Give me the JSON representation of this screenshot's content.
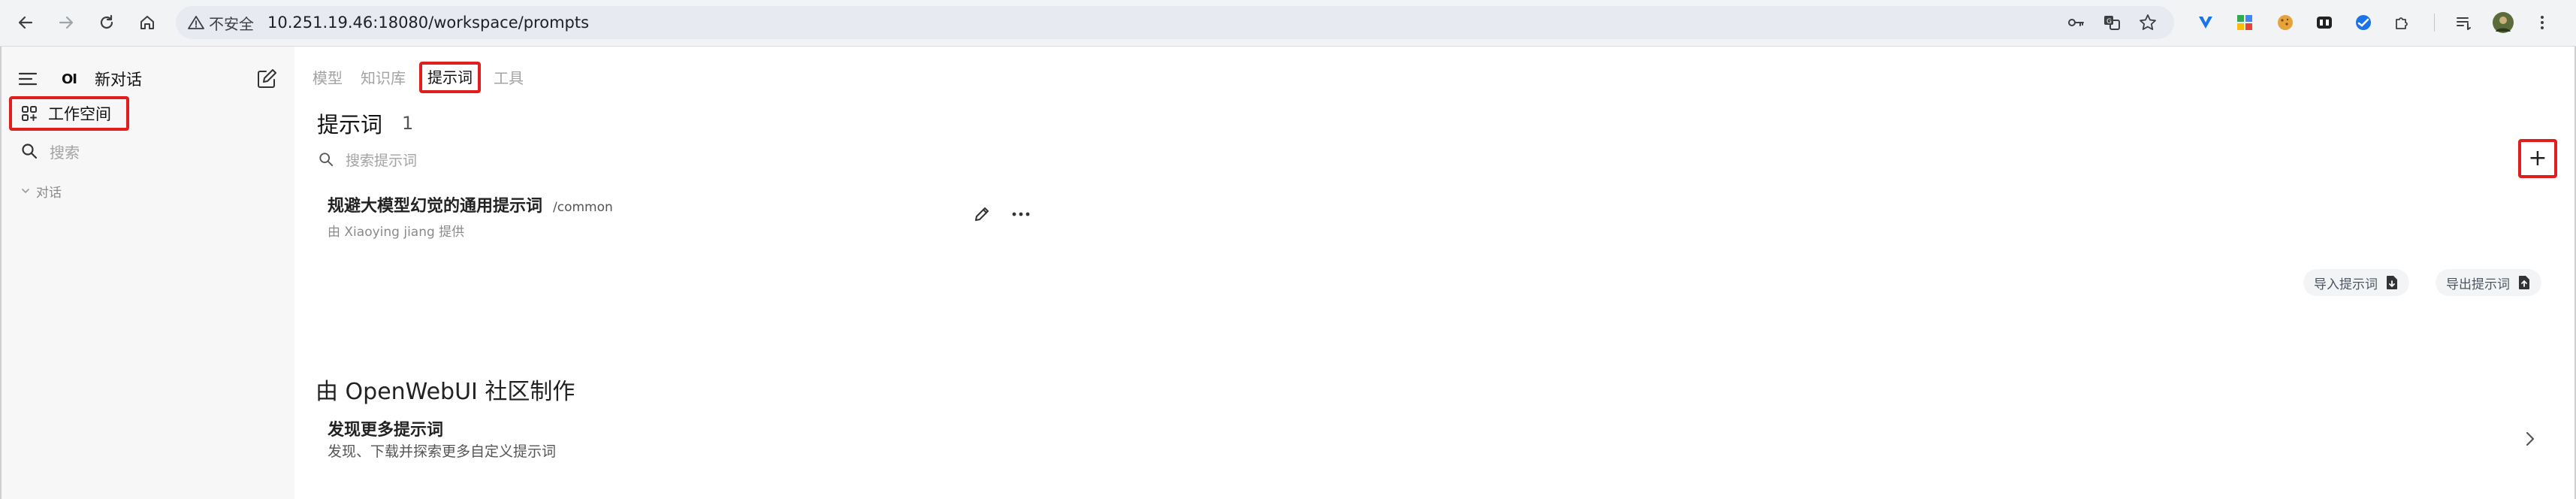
{
  "browser": {
    "insecure_label": "不安全",
    "url": "10.251.19.46:18080/workspace/prompts"
  },
  "sidebar": {
    "logo": "OI",
    "new_chat": "新对话",
    "workspace": "工作空间",
    "search_placeholder": "搜索",
    "section_chats": "对话"
  },
  "tabs": [
    {
      "label": "模型"
    },
    {
      "label": "知识库"
    },
    {
      "label": "提示词",
      "active": true
    },
    {
      "label": "工具"
    }
  ],
  "header": {
    "title": "提示词",
    "count": "1",
    "search_placeholder": "搜索提示词",
    "add_symbol": "+"
  },
  "prompts": [
    {
      "title": "规避大模型幻觉的通用提示词",
      "command": "/common",
      "author": "由 Xiaoying jiang 提供"
    }
  ],
  "actions": {
    "import_label": "导入提示词",
    "export_label": "导出提示词"
  },
  "community": {
    "heading": "由 OpenWebUI 社区制作",
    "card_title": "发现更多提示词",
    "card_subtitle": "发现、下载并探索更多自定义提示词"
  },
  "colors": {
    "highlight": "#e11d1d",
    "sidebar_bg": "#f7f7f8",
    "omnibox_bg": "#e7eaf0"
  }
}
